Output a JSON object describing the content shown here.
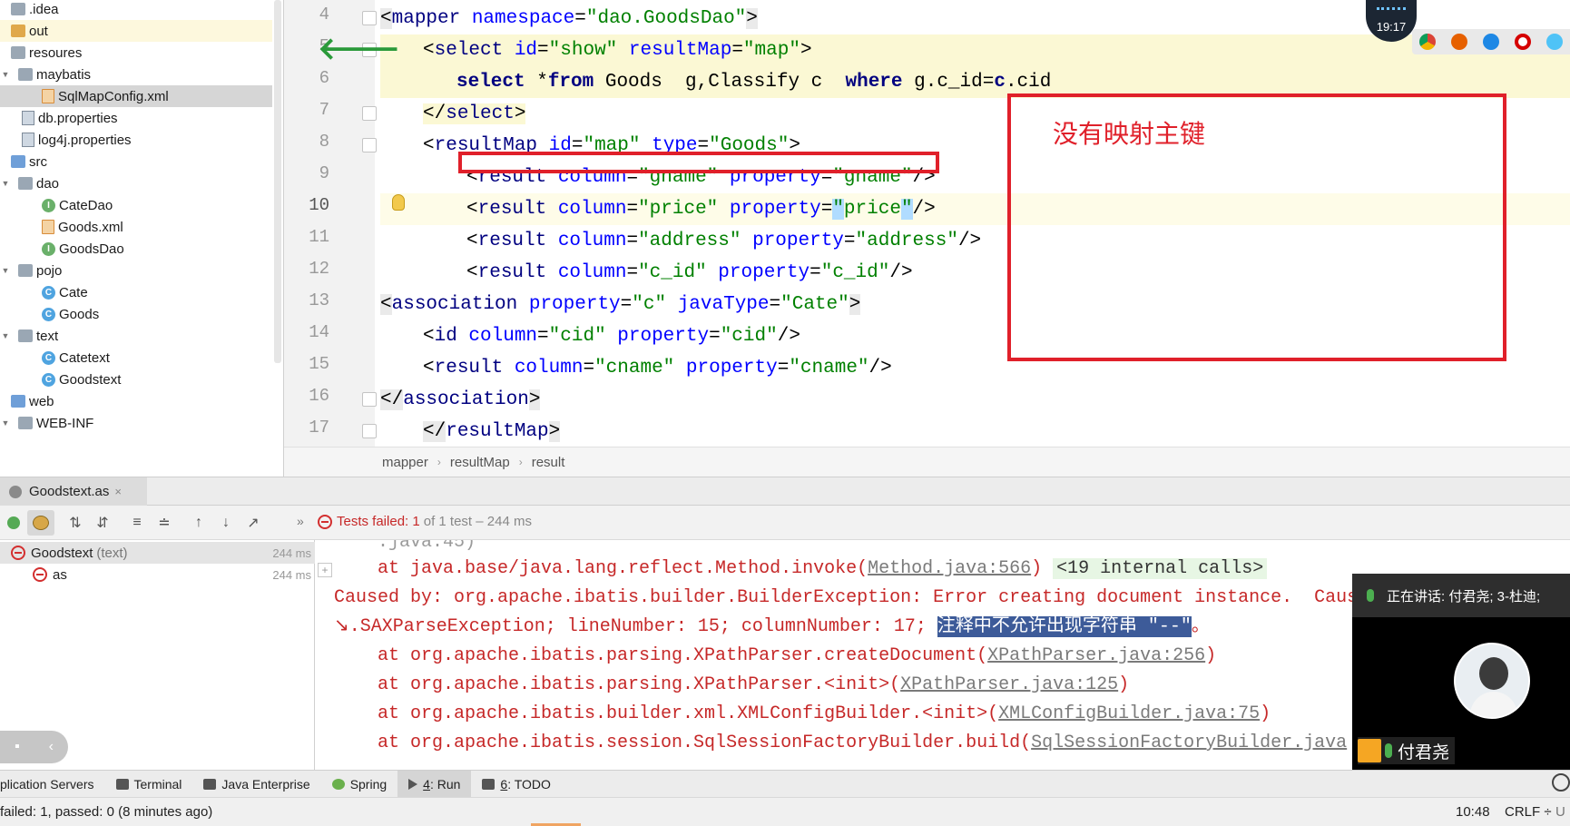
{
  "project_tree": {
    "items": [
      {
        "label": ".idea",
        "kind": "folder"
      },
      {
        "label": "out",
        "kind": "folder-orange"
      },
      {
        "label": "resoures",
        "kind": "folder"
      },
      {
        "label": "maybatis",
        "kind": "folder"
      },
      {
        "label": "SqlMapConfig.xml",
        "kind": "xml"
      },
      {
        "label": "db.properties",
        "kind": "prop"
      },
      {
        "label": "log4j.properties",
        "kind": "prop"
      },
      {
        "label": "src",
        "kind": "folder-blue"
      },
      {
        "label": "dao",
        "kind": "folder"
      },
      {
        "label": "CateDao",
        "kind": "interface"
      },
      {
        "label": "Goods.xml",
        "kind": "xml"
      },
      {
        "label": "GoodsDao",
        "kind": "interface"
      },
      {
        "label": "pojo",
        "kind": "folder"
      },
      {
        "label": "Cate",
        "kind": "class"
      },
      {
        "label": "Goods",
        "kind": "class"
      },
      {
        "label": "text",
        "kind": "folder"
      },
      {
        "label": "Catetext",
        "kind": "class"
      },
      {
        "label": "Goodstext",
        "kind": "class"
      },
      {
        "label": "web",
        "kind": "folder-blue"
      },
      {
        "label": "WEB-INF",
        "kind": "folder"
      }
    ]
  },
  "editor": {
    "line_numbers": [
      "4",
      "5",
      "6",
      "7",
      "8",
      "9",
      "10",
      "11",
      "12",
      "13",
      "14",
      "15",
      "16",
      "17"
    ],
    "breadcrumb": [
      "mapper",
      "resultMap",
      "result"
    ],
    "annotation": "没有映射主键",
    "code": {
      "l4": {
        "a": "<",
        "b": "mapper ",
        "c": "namespace",
        "d": "=",
        "e": "\"dao.GoodsDao\"",
        "f": ">"
      },
      "l5": {
        "a": "<",
        "b": "select ",
        "c": "id",
        "d": "=",
        "e": "\"show\"",
        "f": " resultMap",
        "g": "=",
        "h": "\"map\"",
        "i": ">"
      },
      "l6": {
        "a": "select ",
        "b": "*",
        "c": "from ",
        "d": "Goods  g,Classify c  ",
        "e": "where ",
        "f": "g.c_id=",
        "g": "c",
        "h": ".cid"
      },
      "l7": {
        "a": "</",
        "b": "select",
        "c": ">"
      },
      "l8": {
        "a": "<",
        "b": "resultMap ",
        "c": "id",
        "d": "=",
        "e": "\"map\"",
        "f": " type",
        "g": "=",
        "h": "\"Goods\"",
        "i": ">"
      },
      "l9": {
        "a": "<",
        "b": "result ",
        "c": "column",
        "d": "=",
        "e": "\"gname\"",
        "f": " property",
        "g": "=",
        "h": "\"gname\"",
        "i": "/>"
      },
      "l10": {
        "a": "<",
        "b": "result ",
        "c": "column",
        "d": "=",
        "e": "\"price\"",
        "f": " property",
        "g": "=",
        "h": "\"",
        "i": "price",
        "j": "\"",
        "k": "/>"
      },
      "l11": {
        "a": "<",
        "b": "result ",
        "c": "column",
        "d": "=",
        "e": "\"address\"",
        "f": " property",
        "g": "=",
        "h": "\"address\"",
        "i": "/>"
      },
      "l12": {
        "a": "<",
        "b": "result ",
        "c": "column",
        "d": "=",
        "e": "\"c_id\"",
        "f": " property",
        "g": "=",
        "h": "\"c_id\"",
        "i": "/>"
      },
      "l13": {
        "a": "<",
        "b": "association ",
        "c": "property",
        "d": "=",
        "e": "\"c\"",
        "f": " javaType",
        "g": "=",
        "h": "\"Cate\"",
        "i": ">"
      },
      "l14": {
        "a": "<",
        "b": "id ",
        "c": "column",
        "d": "=",
        "e": "\"cid\"",
        "f": " property",
        "g": "=",
        "h": "\"cid\"",
        "i": "/>"
      },
      "l15": {
        "a": "<",
        "b": "result ",
        "c": "column",
        "d": "=",
        "e": "\"cname\"",
        "f": " property",
        "g": "=",
        "h": "\"cname\"",
        "i": "/>"
      },
      "l16": {
        "a": "</",
        "b": "association",
        "c": ">"
      },
      "l17": {
        "a": "</",
        "b": "resultMap",
        "c": ">"
      }
    }
  },
  "run_panel": {
    "tab_label": "Goodstext.as",
    "tab_close": "×",
    "status_label": "Tests failed:",
    "status_count": "1",
    "status_rest": "of 1 test – 244 ms",
    "overflow": "»",
    "tree": [
      {
        "name": "Goodstext",
        "extra": "(text)",
        "time": "244 ms"
      },
      {
        "name": "as",
        "extra": "",
        "time": "244 ms"
      }
    ],
    "console": {
      "top_cut": ".java:45)",
      "line1_prefix": "at java.base/java.lang.reflect.Method.invoke(",
      "line1_link": "Method.java:566",
      "line1_suffix": ")",
      "line1_internal": "<19 internal calls>",
      "line2": "Caused by: org.apache.ibatis.builder.BuilderException: Error creating document instance.  Caus",
      "line3_prefix": "↘.SAXParseException; lineNumber: 15; columnNumber: 17; ",
      "line3_selected": "注释中不允许出现字符串 \"--\"",
      "line3_suffix": "。",
      "frames": [
        {
          "prefix": "at org.apache.ibatis.parsing.XPathParser.createDocument(",
          "link": "XPathParser.java:256",
          "suffix": ")"
        },
        {
          "prefix": "at org.apache.ibatis.parsing.XPathParser.<init>(",
          "link": "XPathParser.java:125",
          "suffix": ")"
        },
        {
          "prefix": "at org.apache.ibatis.builder.xml.XMLConfigBuilder.<init>(",
          "link": "XMLConfigBuilder.java:75",
          "suffix": ")"
        },
        {
          "prefix": "at org.apache.ibatis.session.SqlSessionFactoryBuilder.build(",
          "link": "SqlSessionFactoryBuilder.java",
          "suffix": ""
        }
      ]
    }
  },
  "tool_windows": [
    {
      "label": "plication Servers",
      "num": ""
    },
    {
      "label": "Terminal",
      "num": ""
    },
    {
      "label": "Java Enterprise",
      "num": ""
    },
    {
      "label": "Spring",
      "num": ""
    },
    {
      "label": ": Run",
      "num": "4"
    },
    {
      "label": ": TODO",
      "num": "6"
    }
  ],
  "status_bar": {
    "message": "failed: 1, passed: 0 (8 minutes ago)",
    "position": "10:48",
    "line_sep": "CRLF ÷",
    "encoding": "U"
  },
  "overlays": {
    "clock": "19:17",
    "meeting_speaking": "正在讲话: 付君尧; 3-杜迪;",
    "meeting_name": "付君尧"
  },
  "colors": {
    "error_red": "#c62828",
    "annotation_red": "#e0202a",
    "tag_blue": "#000080",
    "value_green": "#008000"
  }
}
